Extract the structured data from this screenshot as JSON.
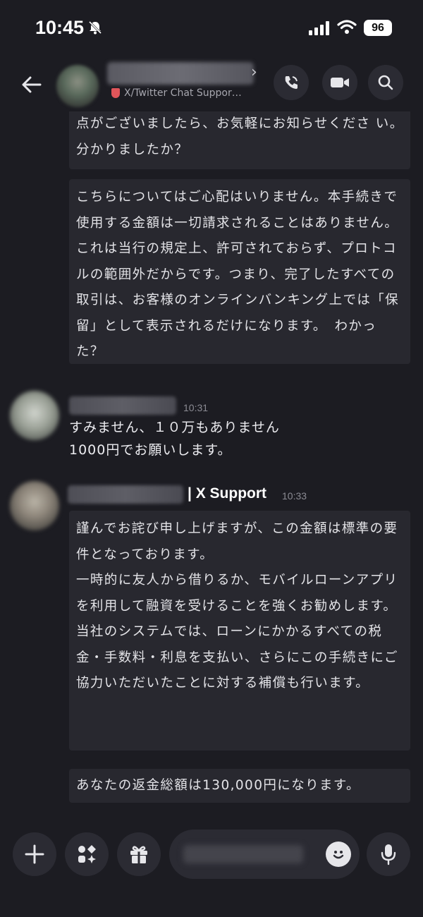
{
  "status": {
    "time": "10:45",
    "battery": "96"
  },
  "header": {
    "subtitle": "X/Twitter Chat Suppor…",
    "icons": [
      "back-arrow-icon",
      "phone-icon",
      "video-icon",
      "search-icon"
    ]
  },
  "messages": {
    "bubble1": "点がございましたら、お気軽にお知らせくださ い。　分かりましたか？",
    "bubble2": "こちらについてはご心配はいりません。本手続きで使用する金額は一切請求されることはありません。これは当行の規定上、許可されておらず、プロトコルの範囲外だからです。つまり、完了したすべての取引は、お客様のオンラインバンキング上では「保留」として表示されるだけになります。　わかった？",
    "user_time": "10:31",
    "user_line1": "すみません、１０万もありません",
    "user_line2": "1000円でお願いします。",
    "support_tag": "| X Support",
    "support_time": "10:33",
    "bubble3": "謹んでお詫び申し上げますが、この金額は標準の要件となっております。\n一時的に友人から借りるか、モバイルローンアプリを利用して融資を受けることを強くお勧めします。\n当社のシステムでは、ローンにかかるすべての税金・手数料・利息を支払い、さらにこの手続きにご協力いただいたことに対する補償も行います。",
    "bubble4": "あなたの返金総額は130,000円になります。"
  },
  "composer": {
    "icons": [
      "plus-icon",
      "apps-icon",
      "gift-icon",
      "emoji-icon",
      "microphone-icon"
    ]
  }
}
